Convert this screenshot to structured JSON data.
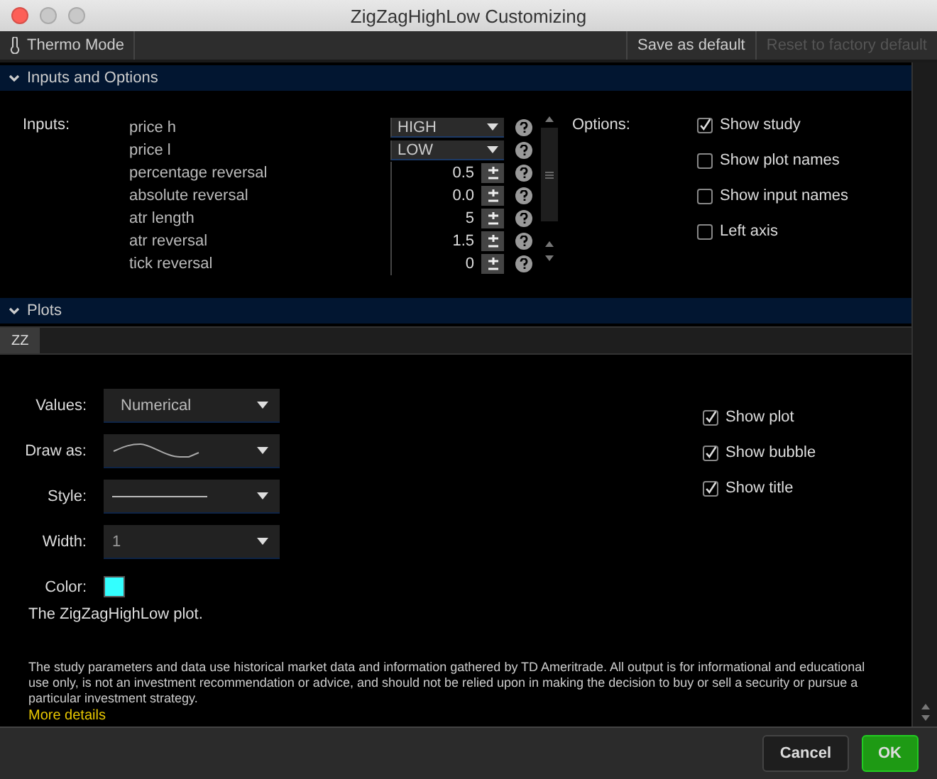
{
  "window": {
    "title": "ZigZagHighLow Customizing"
  },
  "toolbar": {
    "thermo_mode": "Thermo Mode",
    "save_default": "Save as default",
    "reset_default": {
      "label": "Reset to factory default",
      "disabled": true
    }
  },
  "inputs_section": {
    "title": "Inputs and Options",
    "expanded": true,
    "inputs_label": "Inputs:",
    "inputs": [
      {
        "name": "price h",
        "kind": "dropdown",
        "value": "HIGH"
      },
      {
        "name": "price l",
        "kind": "dropdown",
        "value": "LOW"
      },
      {
        "name": "percentage reversal",
        "kind": "number",
        "value": "0.5"
      },
      {
        "name": "absolute reversal",
        "kind": "number",
        "value": "0.0"
      },
      {
        "name": "atr length",
        "kind": "number",
        "value": "5"
      },
      {
        "name": "atr reversal",
        "kind": "number",
        "value": "1.5"
      },
      {
        "name": "tick reversal",
        "kind": "number",
        "value": "0"
      }
    ],
    "options_label": "Options:",
    "options": [
      {
        "label": "Show study",
        "checked": true
      },
      {
        "label": "Show plot names",
        "checked": false
      },
      {
        "label": "Show input names",
        "checked": false
      },
      {
        "label": "Left axis",
        "checked": false
      }
    ]
  },
  "plots_section": {
    "title": "Plots",
    "expanded": true,
    "tabs": [
      {
        "label": "ZZ",
        "selected": true
      }
    ],
    "values": {
      "label": "Values:",
      "value": "Numerical"
    },
    "draw_as": {
      "label": "Draw as:"
    },
    "style": {
      "label": "Style:"
    },
    "width": {
      "label": "Width:",
      "value": "1"
    },
    "color": {
      "label": "Color:",
      "color": "#33ffff"
    },
    "options": [
      {
        "label": "Show plot",
        "checked": true
      },
      {
        "label": "Show bubble",
        "checked": true
      },
      {
        "label": "Show title",
        "checked": true
      }
    ],
    "description": "The ZigZagHighLow plot."
  },
  "disclaimer": "The study parameters and data use historical market data and information gathered by TD Ameritrade. All output is for informational and educational use only, is not an investment recommendation or advice, and should not be relied upon in making the decision to buy or sell a security or pursue a particular investment strategy.",
  "more_details": "More details",
  "buttons": [
    {
      "label": "Cancel",
      "kind": "secondary"
    },
    {
      "label": "OK",
      "kind": "primary"
    }
  ]
}
